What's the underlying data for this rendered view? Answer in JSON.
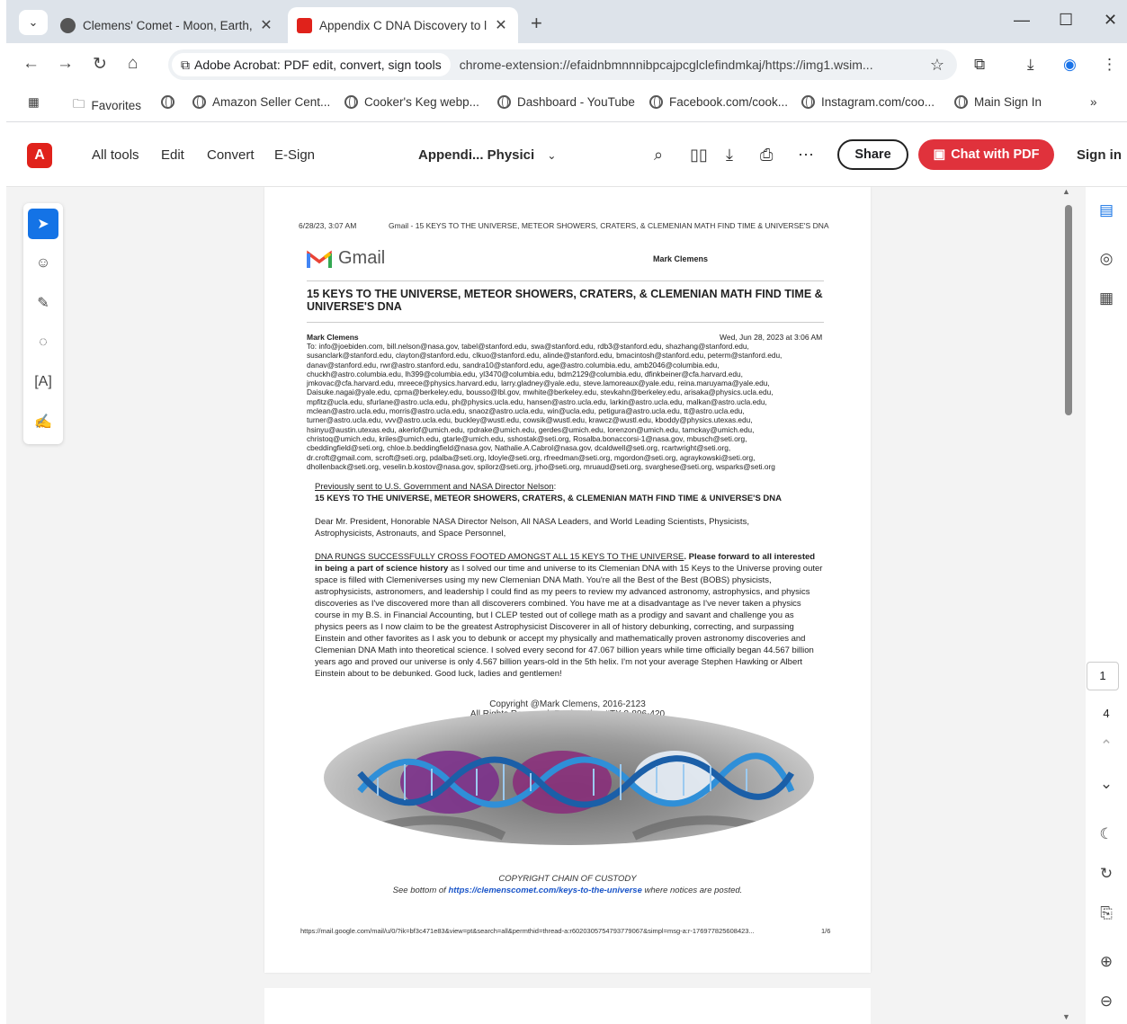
{
  "browser": {
    "tabs": [
      {
        "title": "Clemens' Comet - Moon, Earth,",
        "active": false
      },
      {
        "title": "Appendix C DNA Discovery to l",
        "active": true
      }
    ],
    "new_tab": "+",
    "site_chip": "Adobe Acrobat: PDF edit, convert, sign tools",
    "url": "chrome-extension://efaidnbmnnnibpcajpcglclefindmkaj/https://img1.wsim...",
    "bookmarks": [
      "Favorites",
      "Amazon Seller Cent...",
      "Cooker's Keg webp...",
      "Dashboard - YouTube",
      "Facebook.com/cook...",
      "Instagram.com/coo...",
      "Main Sign In"
    ],
    "more": "»"
  },
  "acrobat": {
    "menu": [
      "All tools",
      "Edit",
      "Convert",
      "E-Sign"
    ],
    "doc_title": "Appendi... Physici",
    "share": "Share",
    "chat": "Chat with PDF",
    "sign_in": "Sign in",
    "page_current": "1",
    "page_total": "4"
  },
  "pdf": {
    "header_date": "6/28/23, 3:07 AM",
    "header_title": "Gmail - 15 KEYS TO THE UNIVERSE, METEOR SHOWERS, CRATERS, & CLEMENIAN MATH FIND TIME & UNIVERSE'S DNA",
    "gmail_logo": "Gmail",
    "account": "Mark Clemens",
    "subject": "15 KEYS TO THE UNIVERSE, METEOR SHOWERS, CRATERS, & CLEMENIAN MATH FIND TIME & UNIVERSE'S DNA",
    "from": "Mark Clemens",
    "date": "Wed, Jun 28, 2023 at 3:06 AM",
    "to_lines": [
      "To: info@joebiden.com, bill.nelson@nasa.gov, tabel@stanford.edu, swa@stanford.edu, rdb3@stanford.edu, shazhang@stanford.edu,",
      "susanclark@stanford.edu, clayton@stanford.edu, clkuo@stanford.edu, alinde@stanford.edu, bmacintosh@stanford.edu, peterm@stanford.edu,",
      "danav@stanford.edu, rwr@astro.stanford.edu, sandra10@stanford.edu, age@astro.columbia.edu, amb2046@columbia.edu,",
      "chuckh@astro.columbia.edu, lh399@columbia.edu, yl3470@columbia.edu, bdm2129@columbia.edu, dfinkbeiner@cfa.harvard.edu,",
      "jmkovac@cfa.harvard.edu, mreece@physics.harvard.edu, larry.gladney@yale.edu, steve.lamoreaux@yale.edu, reina.maruyama@yale.edu,",
      "Daisuke.nagai@yale.edu, cpma@berkeley.edu, bousso@lbl.gov, mwhite@berkeley.edu, stevkahn@berkeley.edu, arisaka@physics.ucla.edu,",
      "mpfitz@ucla.edu, sfurlane@astro.ucla.edu, ph@physics.ucla.edu, hansen@astro.ucla.edu, larkin@astro.ucla.edu, malkan@astro.ucla.edu,",
      "mclean@astro.ucla.edu, morris@astro.ucla.edu, snaoz@astro.ucla.edu, win@ucla.edu, petigura@astro.ucla.edu, tt@astro.ucla.edu,",
      "turner@astro.ucla.edu, vvv@astro.ucla.edu, buckley@wustl.edu, cowsik@wustl.edu, krawcz@wustl.edu, kboddy@physics.utexas.edu,",
      "hsinyu@austin.utexas.edu, akerlof@umich.edu, rpdrake@umich.edu, gerdes@umich.edu, lorenzon@umich.edu, tamckay@umich.edu,",
      "christoq@umich.edu, kriles@umich.edu, gtarle@umich.edu, sshostak@seti.org, Rosalba.bonaccorsi-1@nasa.gov, mbusch@seti.org,",
      "cbeddingfield@seti.org, chloe.b.beddingfield@nasa.gov, Nathalie.A.Cabrol@nasa.gov, dcaldwell@seti.org, rcartwright@seti.org,",
      "dr.croft@gmail.com, scroft@seti.org, pdalba@seti.org, ldoyle@seti.org, rfreedman@seti.org, mgordon@seti.org, agraykowski@seti.org,",
      "dhollenback@seti.org, veselin.b.kostov@nasa.gov, spilorz@seti.org, jrho@seti.org, mruaud@seti.org, svarghese@seti.org, wsparks@seti.org"
    ],
    "prev_sent": "Previously sent to U.S. Government and NASA Director Nelson",
    "prev_colon": ":",
    "prev_title": "15 KEYS TO THE UNIVERSE, METEOR SHOWERS, CRATERS, & CLEMENIAN MATH FIND TIME & UNIVERSE'S DNA",
    "greeting": "Dear Mr. President, Honorable NASA Director Nelson, All NASA Leaders, and World Leading Scientists, Physicists, Astrophysicists, Astronauts, and Space Personnel,",
    "para_u": "DNA RUNGS SUCCESSFULLY CROSS FOOTED AMONGST ALL 15 KEYS TO THE UNIVERSE",
    "para_b": ". Please forward to all interested in being a part of science history",
    "para_rest": " as I solved our time and universe to its Clemenian DNA with 15 Keys to the Universe proving outer space is filled with Clemeniverses using my new Clemenian DNA Math. You're all the Best of the Best (BOBS) physicists, astrophysicists, astronomers, and leadership I could find as my peers to review my advanced astronomy, astrophysics, and physics discoveries as I've discovered more than all discoverers combined. You have me at a disadvantage as I've never taken a physics course in my B.S. in Financial Accounting, but I CLEP tested out of college math as a prodigy and savant and challenge you as physics peers as I now claim to be the greatest Astrophysicist Discoverer in all of history debunking, correcting, and surpassing Einstein and other favorites as I ask you to debunk or accept my physically and mathematically proven astronomy discoveries and Clemenian DNA Math into theoretical science. I solved every second for 47.067 billion years while time officially began 44.567 billion years ago and proved our universe is only 4.567 billion years-old in the 5th helix. I'm not your average Stephen Hawking or Albert Einstein about to be debunked. Good luck, ladies and gentlemen!",
    "img_copy1": "Copyright @Mark Clemens, 2016-2123",
    "img_copy2": "All Rights Reserved, Registration #TX 8-896-420",
    "chain": "COPYRIGHT CHAIN OF CUSTODY",
    "see_pre": "See bottom of ",
    "see_link": "https://clemenscomet.com/keys-to-the-universe",
    "see_post": " where notices are posted.",
    "footer_url": "https://mail.google.com/mail/u/0/?ik=bf3c471e83&view=pt&search=all&permthid=thread-a:r6020305754793779067&simpl=msg-a:r-176977825608423...",
    "footer_page": "1/6"
  }
}
